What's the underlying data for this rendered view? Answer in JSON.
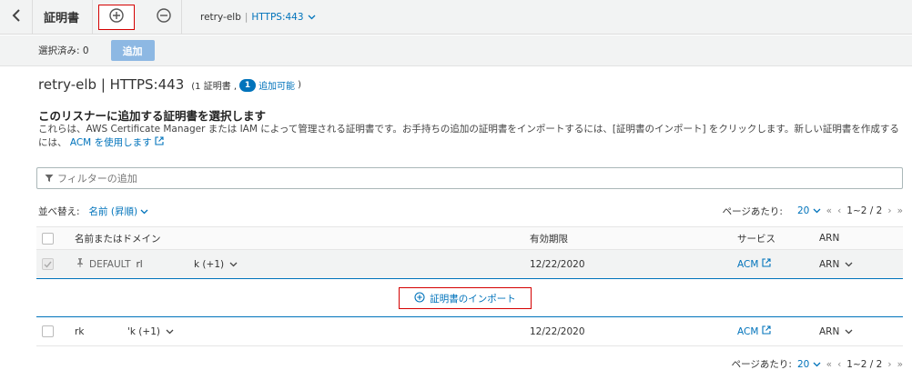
{
  "topbar": {
    "title": "証明書",
    "crumb_name": "retry-elb",
    "crumb_sep": "|",
    "crumb_listener": "HTTPS:443"
  },
  "actionbar": {
    "selected_label": "選択済み: 0",
    "add_label": "追加"
  },
  "header": {
    "title": "retry-elb | HTTPS:443",
    "meta_open": "(1 証明書 ,",
    "badge": "1",
    "meta_link": "追加可能",
    "meta_close": ")"
  },
  "section": {
    "title": "このリスナーに追加する証明書を選択します",
    "desc_text": "これらは、AWS Certificate Manager または IAM によって管理される証明書です。お手持ちの追加の証明書をインポートするには、[証明書のインポート] をクリックします。新しい証明書を作成するには、",
    "desc_link": "ACM を使用します"
  },
  "filter": {
    "placeholder": "フィルターの追加"
  },
  "sort": {
    "label": "並べ替え:",
    "value": "名前 (昇順)"
  },
  "pagination": {
    "per_page_label": "ページあたり:",
    "per_page_value": "20",
    "range": "1~2 / 2"
  },
  "table": {
    "columns": [
      "名前またはドメイン",
      "有効期限",
      "サービス",
      "ARN"
    ],
    "rows": [
      {
        "default_label": "DEFAULT",
        "name_a": "rl",
        "name_b": "k (+1)",
        "expiry": "12/22/2020",
        "service": "ACM",
        "arn": "ARN"
      },
      {
        "name_a": "rk",
        "name_b": "'k (+1)",
        "expiry": "12/22/2020",
        "service": "ACM",
        "arn": "ARN"
      }
    ],
    "import_label": "証明書のインポート"
  },
  "colors": {
    "link": "#0073bb",
    "highlight_border": "#d40000",
    "button_disabled": "#8db8e3"
  }
}
